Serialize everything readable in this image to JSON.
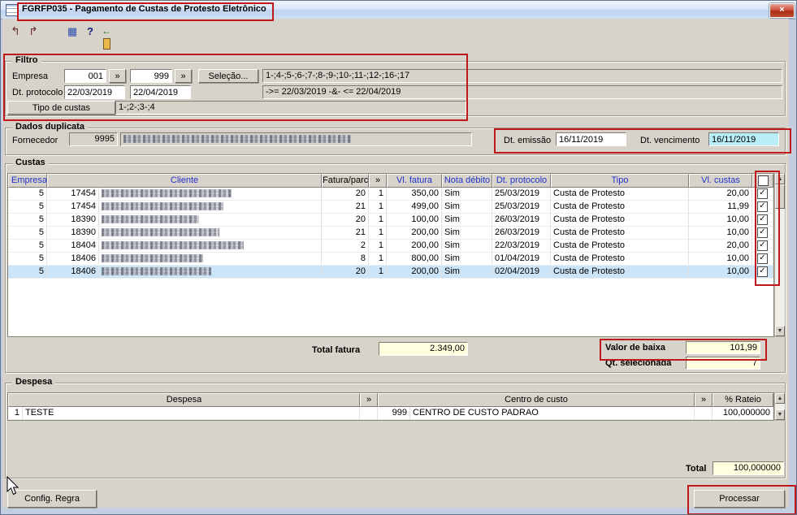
{
  "window": {
    "title": "FGRFP035 - Pagamento de Custas de Protesto Eletrônico",
    "close_glyph": "×"
  },
  "toolbar": {
    "icons": [
      {
        "name": "post-selection-icon",
        "glyph": "↰"
      },
      {
        "name": "post-all-icon",
        "glyph": "↱"
      },
      {
        "name": "grid-icon",
        "glyph": "▦"
      },
      {
        "name": "help-icon",
        "glyph": "?"
      },
      {
        "name": "exit-icon",
        "glyph": "←"
      }
    ]
  },
  "filtro": {
    "title": "Filtro",
    "empresa_label": "Empresa",
    "empresa_from": "001",
    "empresa_to": "999",
    "range_button": "»",
    "selecao_button": "Seleção...",
    "empresa_list": "1-;4-;5-;6-;7-;8-;9-;10-;11-;12-;16-;17",
    "dt_protocolo_label": "Dt. protocolo",
    "dt_from": "22/03/2019",
    "dt_to": "22/04/2019",
    "dt_expr": "->= 22/03/2019 -&- <= 22/04/2019",
    "tipo_custas_button": "Tipo de custas",
    "tipo_custas_value": "1-;2-;3-;4"
  },
  "dados_duplicata": {
    "title": "Dados duplicata",
    "fornecedor_label": "Fornecedor",
    "fornecedor_code": "9995",
    "dt_emissao_label": "Dt. emissão",
    "dt_emissao": "16/11/2019",
    "dt_vencimento_label": "Dt. vencimento",
    "dt_vencimento": "16/11/2019"
  },
  "custas": {
    "title": "Custas",
    "columns": [
      "Empresa",
      "Cliente",
      "Fatura/parc.",
      "»",
      "Vl. fatura",
      "Nota débito",
      "Dt. protocolo",
      "Tipo",
      "Vl. custas"
    ],
    "rows": [
      {
        "empresa": "5",
        "cliente_code": "17454",
        "fatura": "20",
        "parc": "1",
        "vl_fatura": "350,00",
        "nota_debito": "Sim",
        "dt_protocolo": "25/03/2019",
        "tipo": "Custa de Protesto",
        "vl_custas": "20,00",
        "check": "✓"
      },
      {
        "empresa": "5",
        "cliente_code": "17454",
        "fatura": "21",
        "parc": "1",
        "vl_fatura": "499,00",
        "nota_debito": "Sim",
        "dt_protocolo": "25/03/2019",
        "tipo": "Custa de Protesto",
        "vl_custas": "11,99",
        "check": "✓"
      },
      {
        "empresa": "5",
        "cliente_code": "18390",
        "fatura": "20",
        "parc": "1",
        "vl_fatura": "100,00",
        "nota_debito": "Sim",
        "dt_protocolo": "26/03/2019",
        "tipo": "Custa de Protesto",
        "vl_custas": "10,00",
        "check": "✓"
      },
      {
        "empresa": "5",
        "cliente_code": "18390",
        "fatura": "21",
        "parc": "1",
        "vl_fatura": "200,00",
        "nota_debito": "Sim",
        "dt_protocolo": "26/03/2019",
        "tipo": "Custa de Protesto",
        "vl_custas": "10,00",
        "check": "✓"
      },
      {
        "empresa": "5",
        "cliente_code": "18404",
        "fatura": "2",
        "parc": "1",
        "vl_fatura": "200,00",
        "nota_debito": "Sim",
        "dt_protocolo": "22/03/2019",
        "tipo": "Custa de Protesto",
        "vl_custas": "20,00",
        "check": "✓"
      },
      {
        "empresa": "5",
        "cliente_code": "18406",
        "fatura": "8",
        "parc": "1",
        "vl_fatura": "800,00",
        "nota_debito": "Sim",
        "dt_protocolo": "01/04/2019",
        "tipo": "Custa de Protesto",
        "vl_custas": "10,00",
        "check": "✓"
      },
      {
        "empresa": "5",
        "cliente_code": "18406",
        "fatura": "20",
        "parc": "1",
        "vl_fatura": "200,00",
        "nota_debito": "Sim",
        "dt_protocolo": "02/04/2019",
        "tipo": "Custa de Protesto",
        "vl_custas": "10,00",
        "check": "✓"
      }
    ],
    "total_fatura_label": "Total fatura",
    "total_fatura": "2.349,00",
    "valor_baixa_label": "Valor de baixa",
    "valor_baixa": "101,99",
    "qt_selecionada_label": "Qt. selecionada",
    "qt_selecionada": "7"
  },
  "despesa": {
    "title": "Despesa",
    "columns": [
      "Despesa",
      "»",
      "Centro de custo",
      "»",
      "% Rateio"
    ],
    "row": {
      "code": "1",
      "name": "TESTE",
      "cc_code": "999",
      "cc_name": "CENTRO DE CUSTO PADRAO",
      "rateio": "100,000000"
    },
    "total_label": "Total",
    "total": "100,000000"
  },
  "footer": {
    "config_regra_button": "Config. Regra",
    "processar_button": "Processar"
  },
  "colors": {
    "annotation": "#c0171c",
    "highlighted_field": "#b9eef7",
    "selected_row": "#cbe4f7",
    "calculated_field": "#ffffe0",
    "header_link": "#2233cc"
  }
}
